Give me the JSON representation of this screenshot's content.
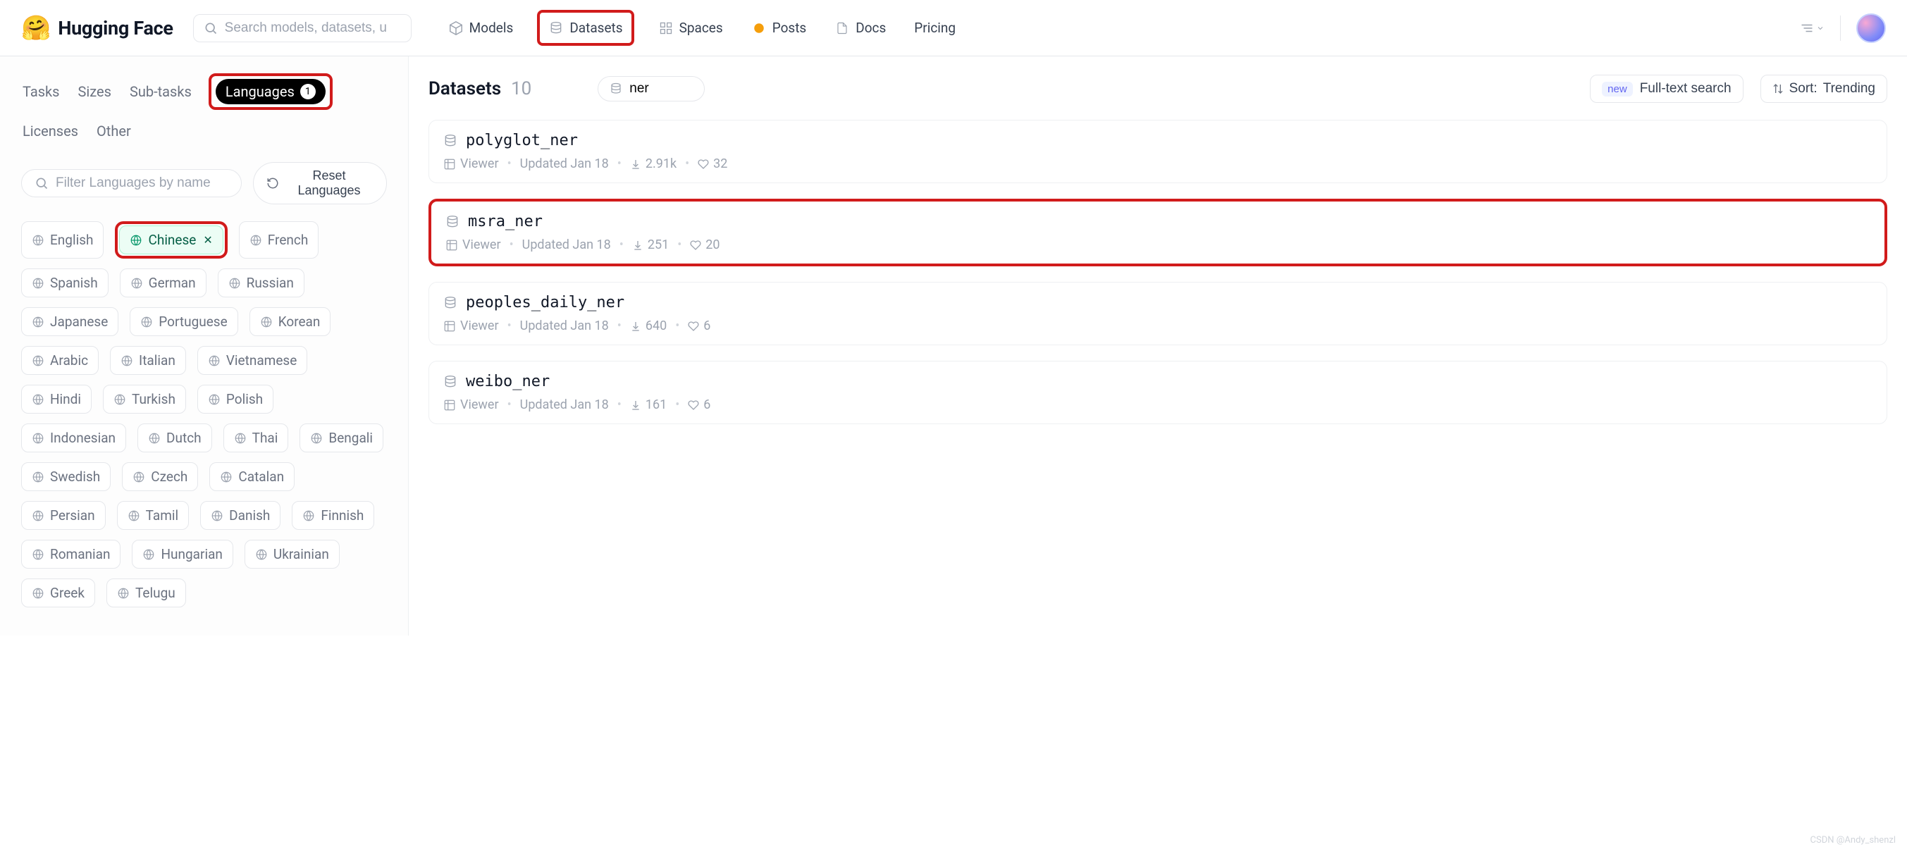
{
  "brand": "Hugging Face",
  "search_placeholder": "Search models, datasets, u",
  "nav": {
    "models": "Models",
    "datasets": "Datasets",
    "spaces": "Spaces",
    "posts": "Posts",
    "docs": "Docs",
    "pricing": "Pricing"
  },
  "sidebar": {
    "tabs": {
      "tasks": "Tasks",
      "sizes": "Sizes",
      "subtasks": "Sub-tasks",
      "languages": "Languages",
      "languages_count": "1",
      "licenses": "Licenses",
      "other": "Other"
    },
    "filter_placeholder": "Filter Languages by name",
    "reset_label": "Reset Languages",
    "selected_language": "Chinese",
    "languages": [
      "English",
      "Chinese",
      "French",
      "Spanish",
      "German",
      "Russian",
      "Japanese",
      "Portuguese",
      "Korean",
      "Arabic",
      "Italian",
      "Vietnamese",
      "Hindi",
      "Turkish",
      "Polish",
      "Indonesian",
      "Dutch",
      "Thai",
      "Bengali",
      "Swedish",
      "Czech",
      "Catalan",
      "Persian",
      "Tamil",
      "Danish",
      "Finnish",
      "Romanian",
      "Hungarian",
      "Ukrainian",
      "Greek",
      "Telugu"
    ]
  },
  "content": {
    "title": "Datasets",
    "count": "10",
    "search_value": "ner",
    "fts_new": "new",
    "fts_label": "Full-text search",
    "sort_prefix": "Sort: ",
    "sort_value": "Trending"
  },
  "cards": [
    {
      "name": "polyglot_ner",
      "viewer": "Viewer",
      "updated": "Updated Jan 18",
      "downloads": "2.91k",
      "likes": "32"
    },
    {
      "name": "msra_ner",
      "viewer": "Viewer",
      "updated": "Updated Jan 18",
      "downloads": "251",
      "likes": "20",
      "highlight": true
    },
    {
      "name": "peoples_daily_ner",
      "viewer": "Viewer",
      "updated": "Updated Jan 18",
      "downloads": "640",
      "likes": "6"
    },
    {
      "name": "weibo_ner",
      "viewer": "Viewer",
      "updated": "Updated Jan 18",
      "downloads": "161",
      "likes": "6"
    }
  ],
  "watermark": "CSDN @Andy_shenzl"
}
